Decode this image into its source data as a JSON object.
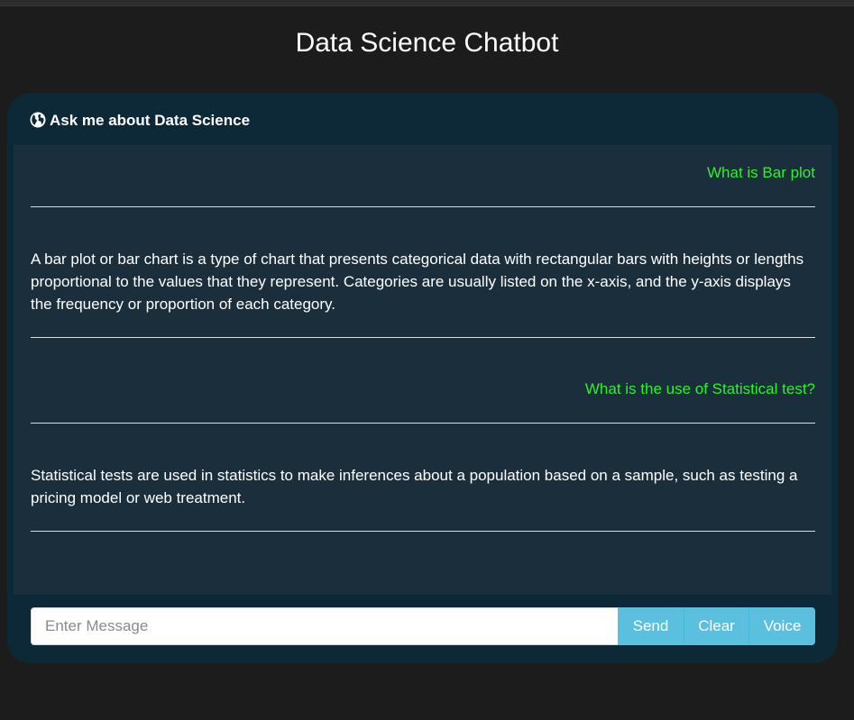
{
  "page": {
    "title": "Data Science Chatbot"
  },
  "panel": {
    "icon": "globe-icon",
    "title": "Ask me about Data Science"
  },
  "messages": [
    {
      "role": "user",
      "text": "What is Bar plot"
    },
    {
      "role": "bot",
      "text": "A bar plot or bar chart is a type of chart that presents categorical data with rectangular bars with heights or lengths proportional to the values that they represent. Categories are usually listed on the x-axis, and the y-axis displays the frequency or proportion of each category."
    },
    {
      "role": "user",
      "text": "What is the use of Statistical test?"
    },
    {
      "role": "bot",
      "text": "Statistical tests are used in statistics to make inferences about a population based on a sample, such as testing a pricing model or web treatment."
    }
  ],
  "input": {
    "placeholder": "Enter Message",
    "value": ""
  },
  "buttons": {
    "send": "Send",
    "clear": "Clear",
    "voice": "Voice"
  },
  "colors": {
    "background": "#1c1c1c",
    "panel": "#0d2937",
    "messages_area": "#1b2e3c",
    "user_text": "#2ef02e",
    "bot_text": "#ffffff",
    "button": "#5bc0de"
  }
}
